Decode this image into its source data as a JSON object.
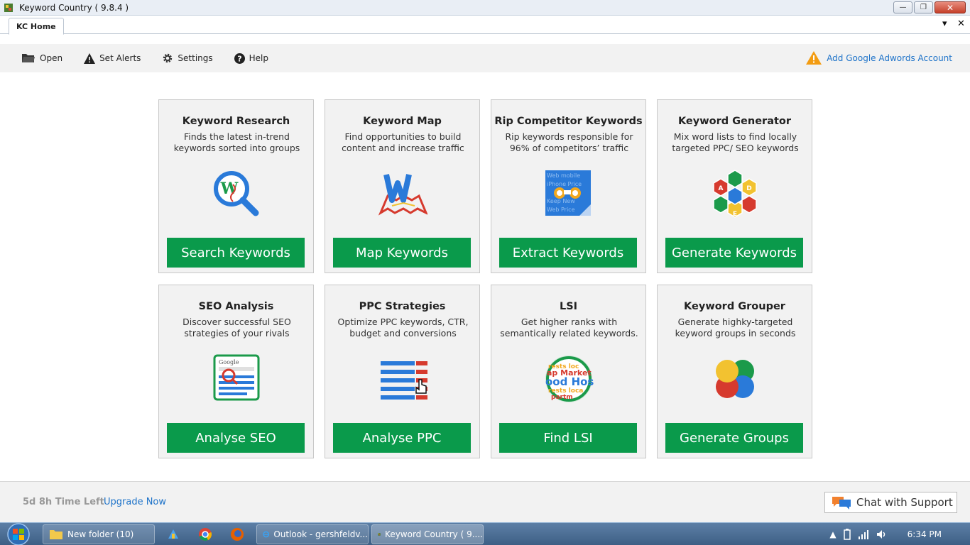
{
  "window": {
    "title": "Keyword Country ( 9.8.4 )"
  },
  "tabs": [
    {
      "label": "KC Home"
    }
  ],
  "toolbar": {
    "open_label": "Open",
    "alerts_label": "Set Alerts",
    "settings_label": "Settings",
    "help_label": "Help",
    "adwords_label": "Add Google Adwords Account"
  },
  "cards": [
    {
      "title": "Keyword Research",
      "desc": "Finds the latest in-trend keywords sorted into groups",
      "button": "Search Keywords",
      "icon": "magnifier-wiki-icon"
    },
    {
      "title": "Keyword Map",
      "desc": "Find opportunities to build content and increase traffic",
      "button": "Map Keywords",
      "icon": "map-icon"
    },
    {
      "title": "Rip Competitor Keywords",
      "desc": "Rip keywords responsible for 96% of competitors’ traffic",
      "button": "Extract Keywords",
      "icon": "binoculars-icon"
    },
    {
      "title": "Keyword Generator",
      "desc": "Mix word lists to find locally targeted PPC/ SEO keywords",
      "button": "Generate Keywords",
      "icon": "hexagon-cluster-icon"
    },
    {
      "title": "SEO Analysis",
      "desc": "Discover successful SEO strategies of your rivals",
      "button": "Analyse SEO",
      "icon": "google-search-icon"
    },
    {
      "title": "PPC Strategies",
      "desc": "Optimize PPC keywords, CTR, budget and conversions",
      "button": "Analyse PPC",
      "icon": "ppc-bars-icon"
    },
    {
      "title": "LSI",
      "desc": "Get higher ranks with semantically related keywords.",
      "button": "Find LSI",
      "icon": "lsi-circle-icon"
    },
    {
      "title": "Keyword Grouper",
      "desc": "Generate highky-targeted keyword groups in seconds",
      "button": "Generate Groups",
      "icon": "circles-group-icon"
    }
  ],
  "footer": {
    "time_left": "5d 8h Time Left",
    "upgrade": "Upgrade Now",
    "chat": "Chat with Support"
  },
  "taskbar": {
    "tasks": [
      {
        "label": "New folder (10)"
      },
      {
        "label": "Outlook - gershfeldv..."
      },
      {
        "label": "Keyword Country ( 9...."
      }
    ],
    "clock": "6:34 PM"
  },
  "colors": {
    "accent_green": "#0a9a4b",
    "link_blue": "#1e73c9",
    "warning_orange": "#f39c12"
  }
}
